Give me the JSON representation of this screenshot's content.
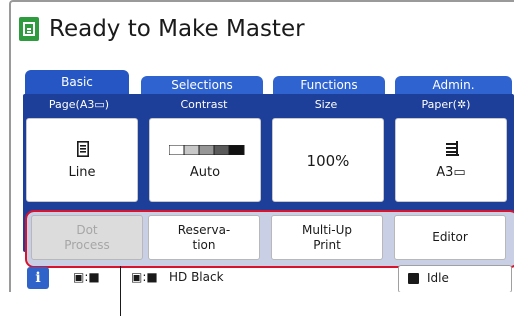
{
  "app": {
    "title": "Ready to Make Master"
  },
  "tabs": [
    {
      "label": "Basic",
      "color": "#2556c4"
    },
    {
      "label": "Selections",
      "color": "#2f63d0"
    },
    {
      "label": "Functions",
      "color": "#2f63d0"
    },
    {
      "label": "Admin.",
      "color": "#2f63d0"
    }
  ],
  "settings": [
    {
      "header": "Page(A3▭)",
      "label": "Line",
      "icon": "document-icon"
    },
    {
      "header": "Contrast",
      "label": "Auto",
      "icon": "contrast-scale-icon"
    },
    {
      "header": "Size",
      "value": "100%"
    },
    {
      "header": "Paper(✲)",
      "label": "A3▭",
      "icon": "paper-stack-icon"
    }
  ],
  "functions": [
    {
      "line1": "Dot",
      "line2": "Process",
      "enabled": false
    },
    {
      "line1": "Reserva-",
      "line2": "tion",
      "enabled": true
    },
    {
      "line1": "Multi-Up",
      "line2": "Print",
      "enabled": true
    },
    {
      "line1": "Editor",
      "line2": "",
      "enabled": true
    }
  ],
  "status": {
    "info_label": "i",
    "master_label": "▣:■",
    "ink_prefix": "▣:■",
    "ink_label": "HD Black",
    "state": "Idle"
  },
  "colors": {
    "panel": "#1d3f9a",
    "highlight": "#d8132d",
    "title_icon": "#2e9b3e"
  }
}
